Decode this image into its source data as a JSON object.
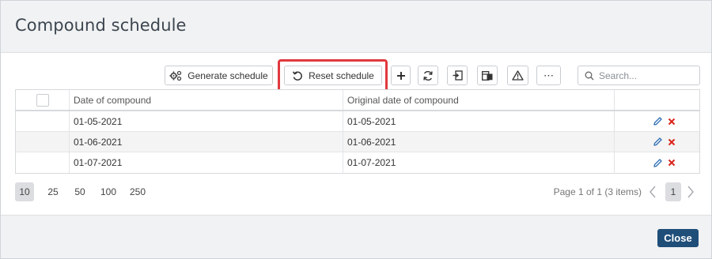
{
  "dialog": {
    "title": "Compound schedule"
  },
  "toolbar": {
    "generate_label": "Generate schedule",
    "reset_label": "Reset schedule",
    "more_label": "⋯",
    "search_placeholder": "Search..."
  },
  "grid": {
    "columns": [
      "Date of compound",
      "Original date of compound"
    ],
    "rows": [
      {
        "date": "01-05-2021",
        "original": "01-05-2021"
      },
      {
        "date": "01-06-2021",
        "original": "01-06-2021"
      },
      {
        "date": "01-07-2021",
        "original": "01-07-2021"
      }
    ]
  },
  "pager": {
    "sizes": [
      "10",
      "25",
      "50",
      "100",
      "250"
    ],
    "selected_size": "10",
    "info": "Page 1 of 1 (3 items)",
    "current_page": "1"
  },
  "footer": {
    "close_label": "Close"
  },
  "colors": {
    "highlight": "#e0393e",
    "close_button": "#1f4e79",
    "edit_icon": "#2f6fb5",
    "delete_icon": "#d9261c"
  }
}
